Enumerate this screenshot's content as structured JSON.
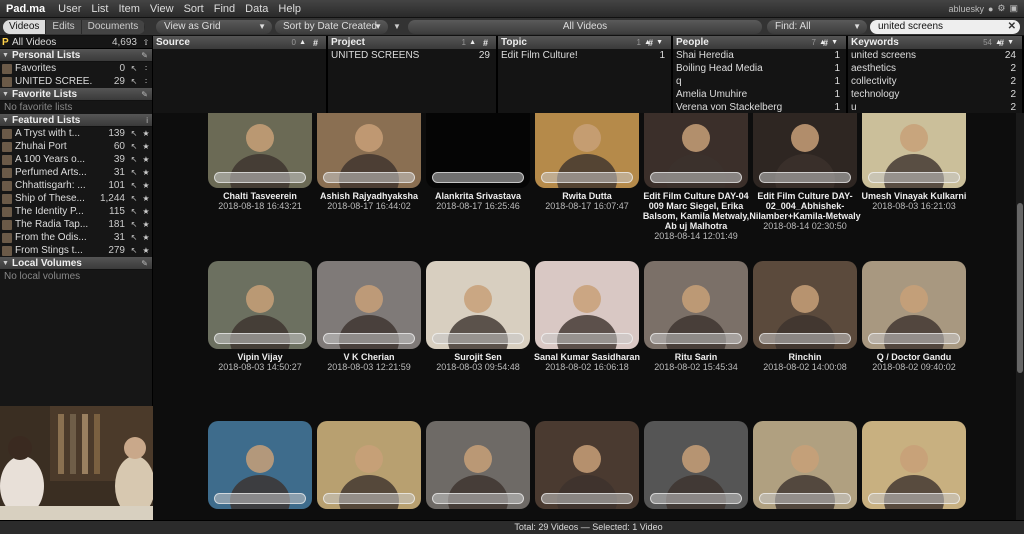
{
  "menu": {
    "logo": "Pad.ma",
    "items": [
      "User",
      "List",
      "Item",
      "View",
      "Sort",
      "Find",
      "Data",
      "Help"
    ],
    "username": "abluesky"
  },
  "toolbar": {
    "sections": [
      "Videos",
      "Edits",
      "Documents"
    ],
    "view": "View as Grid",
    "sort": "Sort by Date Created",
    "list_title": "All Videos",
    "find_scope": "Find: All",
    "search_value": "united screens"
  },
  "sidebar": {
    "all_videos": {
      "label": "All Videos",
      "count": "4,693"
    },
    "personal": {
      "title": "Personal Lists",
      "items": [
        {
          "label": "Favorites",
          "count": "0"
        },
        {
          "label": "UNITED SCREE...",
          "count": "29"
        }
      ]
    },
    "favorite": {
      "title": "Favorite Lists",
      "empty": "No favorite lists"
    },
    "featured": {
      "title": "Featured Lists",
      "items": [
        {
          "label": "A Tryst with t...",
          "count": "139"
        },
        {
          "label": "Zhuhai Port",
          "count": "60"
        },
        {
          "label": "A 100 Years o...",
          "count": "39"
        },
        {
          "label": "Perfumed Arts...",
          "count": "31"
        },
        {
          "label": "Chhattisgarh: ...",
          "count": "101"
        },
        {
          "label": "Ship of These...",
          "count": "1,244"
        },
        {
          "label": "The Identity P...",
          "count": "115"
        },
        {
          "label": "The Radia Tap...",
          "count": "181"
        },
        {
          "label": "From the Odis...",
          "count": "31"
        },
        {
          "label": "From Stings t...",
          "count": "279"
        }
      ]
    },
    "local": {
      "title": "Local Volumes",
      "empty": "No local volumes"
    }
  },
  "browser": {
    "columns": [
      {
        "title": "Source",
        "count": "0",
        "rows": []
      },
      {
        "title": "Project",
        "count": "1",
        "rows": [
          {
            "value": "UNITED SCREENS",
            "count": "29"
          }
        ]
      },
      {
        "title": "Topic",
        "count": "1",
        "rows": [
          {
            "value": "Edit Film Culture!",
            "count": "1"
          }
        ]
      },
      {
        "title": "People",
        "count": "7",
        "rows": [
          {
            "value": "Shai Heredia",
            "count": "1"
          },
          {
            "value": "Boiling Head Media",
            "count": "1"
          },
          {
            "value": "q",
            "count": "1"
          },
          {
            "value": "Amelia Umuhire",
            "count": "1"
          },
          {
            "value": "Verena von Stackelberg",
            "count": "1"
          }
        ]
      },
      {
        "title": "Keywords",
        "count": "54",
        "rows": [
          {
            "value": "united screens",
            "count": "24"
          },
          {
            "value": "aesthetics",
            "count": "2"
          },
          {
            "value": "collectivity",
            "count": "2"
          },
          {
            "value": "technology",
            "count": "2"
          },
          {
            "value": "u",
            "count": "2"
          }
        ]
      }
    ]
  },
  "videos": [
    {
      "title": "Chalti Tasveerein",
      "date": "2018-08-18 16:43:21"
    },
    {
      "title": "Ashish Rajyadhyaksha",
      "date": "2018-08-17 16:44:02"
    },
    {
      "title": "Alankrita Srivastava",
      "date": "2018-08-17 16:25:46"
    },
    {
      "title": "Rwita Dutta",
      "date": "2018-08-17 16:07:47"
    },
    {
      "title": "Edit Film Culture DAY-04 009 Marc Siegel, Erika Balsom, Kamila Metwaly, Ab  uj Malhotra",
      "date": "2018-08-14 12:01:49"
    },
    {
      "title": "Edit Film Culture DAY-02_004_Abhishek-Nilamber+Kamila-Metwaly",
      "date": "2018-08-14 02:30:50"
    },
    {
      "title": "Umesh Vinayak Kulkarni",
      "date": "2018-08-03 16:21:03"
    },
    {
      "title": "Vipin Vijay",
      "date": "2018-08-03 14:50:27"
    },
    {
      "title": "V K Cherian",
      "date": "2018-08-03 12:21:59"
    },
    {
      "title": "Surojit Sen",
      "date": "2018-08-03 09:54:48"
    },
    {
      "title": "Sanal Kumar Sasidharan",
      "date": "2018-08-02 16:06:18"
    },
    {
      "title": "Ritu Sarin",
      "date": "2018-08-02 15:45:34"
    },
    {
      "title": "Rinchin",
      "date": "2018-08-02 14:00:08"
    },
    {
      "title": "Q / Doctor Gandu",
      "date": "2018-08-02 09:40:02"
    },
    {
      "title": "",
      "date": ""
    },
    {
      "title": "",
      "date": ""
    },
    {
      "title": "",
      "date": ""
    },
    {
      "title": "",
      "date": ""
    },
    {
      "title": "",
      "date": ""
    },
    {
      "title": "",
      "date": ""
    },
    {
      "title": "",
      "date": ""
    }
  ],
  "thumb_colors": [
    "#6b6a55",
    "#8a6f52",
    "#050505",
    "#b58a4a",
    "#3b2f2a",
    "#2e2622",
    "#cbbf9a",
    "#6c7060",
    "#7f7a78",
    "#d8cfc0",
    "#d9c8c4",
    "#7b7068",
    "#5b4a3c",
    "#a89880",
    "#3e6c8c",
    "#b8a070",
    "#6e6a66",
    "#4a3a30",
    "#555555",
    "#b0a080",
    "#c8b080"
  ],
  "status": "Total: 29 Videos — Selected: 1 Video"
}
